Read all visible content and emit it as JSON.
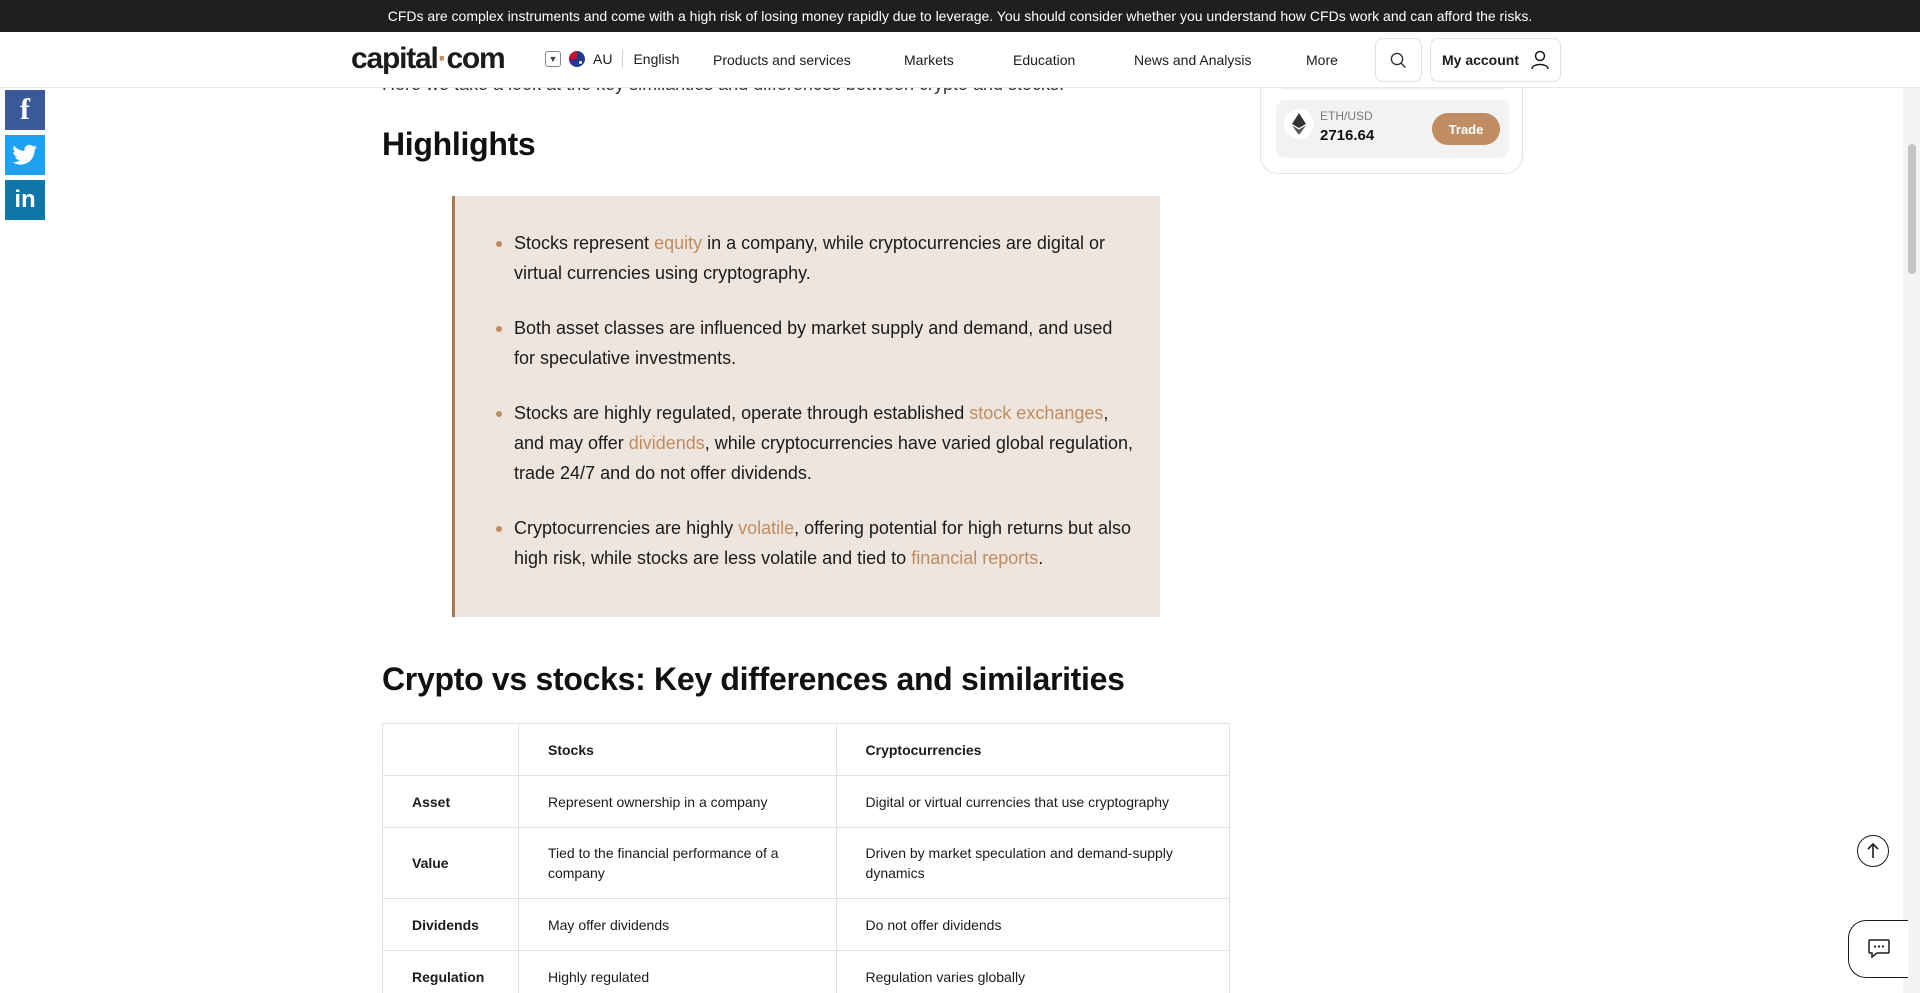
{
  "risk_banner": "CFDs are complex instruments and come with a high risk of losing money rapidly due to leverage. You should consider whether you understand how CFDs work and can afford the risks.",
  "header": {
    "logo_left": "capital",
    "logo_dot": "·",
    "logo_right": "com",
    "region_code": "AU",
    "language": "English",
    "nav": [
      "Products and services",
      "Markets",
      "Education",
      "News and Analysis",
      "More"
    ],
    "account_label": "My account"
  },
  "share": {
    "facebook": "f",
    "linkedin": "in"
  },
  "article": {
    "intro_partial": "Here we take a look at the key similarities and differences between crypto and stocks.",
    "highlights_heading": "Highlights",
    "bullets": {
      "b1": {
        "t1": "Stocks represent ",
        "l1": "equity",
        "t2": " in a company, while cryptocurrencies are digital or virtual currencies using cryptography."
      },
      "b2": {
        "t1": "Both asset classes are influenced by market supply and demand, and used for speculative investments."
      },
      "b3": {
        "t1": "Stocks are highly regulated, operate through established ",
        "l1": "stock exchanges",
        "t2": ", and may offer ",
        "l2": "dividends",
        "t3": ", while cryptocurrencies have varied global regulation, trade 24/7 and do not offer dividends."
      },
      "b4": {
        "t1": "Cryptocurrencies are highly ",
        "l1": "volatile",
        "t2": ", offering potential for high returns but also high risk, while stocks are less volatile and tied to ",
        "l2": "financial reports",
        "t3": "."
      }
    },
    "comparison_heading": "Crypto vs stocks: Key differences and similarities",
    "table": {
      "headers": [
        "",
        "Stocks",
        "Cryptocurrencies"
      ],
      "rows": [
        [
          "Asset",
          "Represent ownership in a company",
          "Digital or virtual currencies that use cryptography"
        ],
        [
          "Value",
          "Tied to the financial performance of a company",
          "Driven by market speculation and demand-supply dynamics"
        ],
        [
          "Dividends",
          "May offer dividends",
          "Do not offer dividends"
        ],
        [
          "Regulation",
          "Highly regulated",
          "Regulation varies globally"
        ]
      ]
    }
  },
  "widget": {
    "pair": "ETH/USD",
    "price": "2716.64",
    "trade_label": "Trade"
  },
  "colors": {
    "accent": "#c08d62",
    "highlight_bg": "#ede5de",
    "banner_bg": "#1f1f1f"
  }
}
